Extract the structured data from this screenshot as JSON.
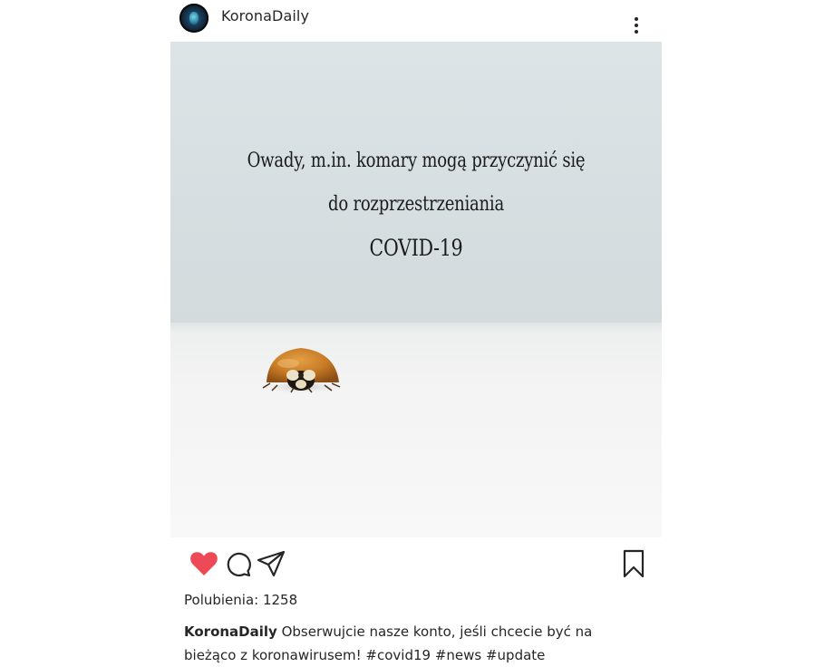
{
  "post": {
    "username": "KoronaDaily",
    "image_text": {
      "line1": "Owady, m.in. komary mogą przyczynić się",
      "line2": "do rozprzestrzeniania",
      "line3": "COVID-19"
    },
    "likes_label": "Polubienia: 1258",
    "caption": {
      "author": "KoronaDaily",
      "text": "Obserwujcie nasze konto, jeśli chcecie być na bieżąco z koronawirusem! #covid19 #news #update"
    },
    "liked": true
  },
  "colors": {
    "heart": "#ed4956",
    "text": "#262626"
  },
  "icons": {
    "avatar": "profile-avatar",
    "more": "more-options-icon",
    "like": "heart-icon",
    "comment": "comment-icon",
    "share": "share-icon",
    "save": "bookmark-icon"
  }
}
